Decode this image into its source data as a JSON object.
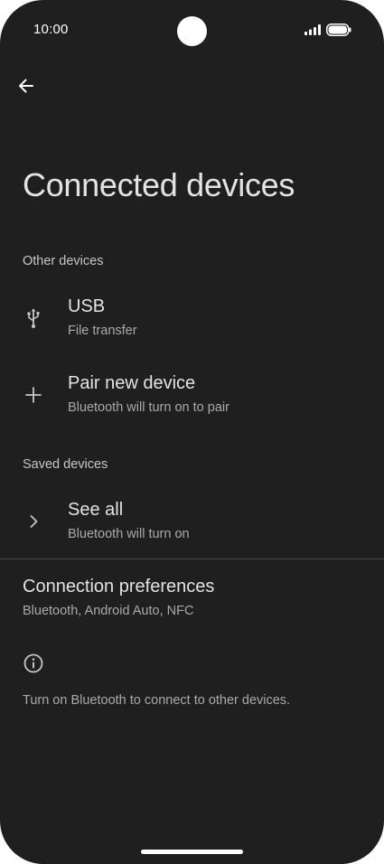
{
  "status_bar": {
    "time": "10:00"
  },
  "header": {
    "back_icon": "arrow-back-icon",
    "title": "Connected devices"
  },
  "other_devices": {
    "header": "Other devices",
    "items": [
      {
        "icon": "usb-icon",
        "title": "USB",
        "subtitle": "File transfer"
      },
      {
        "icon": "plus-icon",
        "title": "Pair new device",
        "subtitle": "Bluetooth will turn on to pair"
      }
    ]
  },
  "saved_devices": {
    "header": "Saved devices",
    "items": [
      {
        "icon": "chevron-right-icon",
        "title": "See all",
        "subtitle": "Bluetooth will turn on"
      }
    ]
  },
  "connection_preferences": {
    "title": "Connection preferences",
    "subtitle": "Bluetooth, Android Auto, NFC"
  },
  "footer": {
    "icon": "info-icon",
    "text": "Turn on Bluetooth to connect to other devices."
  },
  "colors": {
    "background": "#1f1f1f",
    "primary_text": "#e3e3e3",
    "secondary_text": "#a8aaa8",
    "divider": "#444746"
  }
}
